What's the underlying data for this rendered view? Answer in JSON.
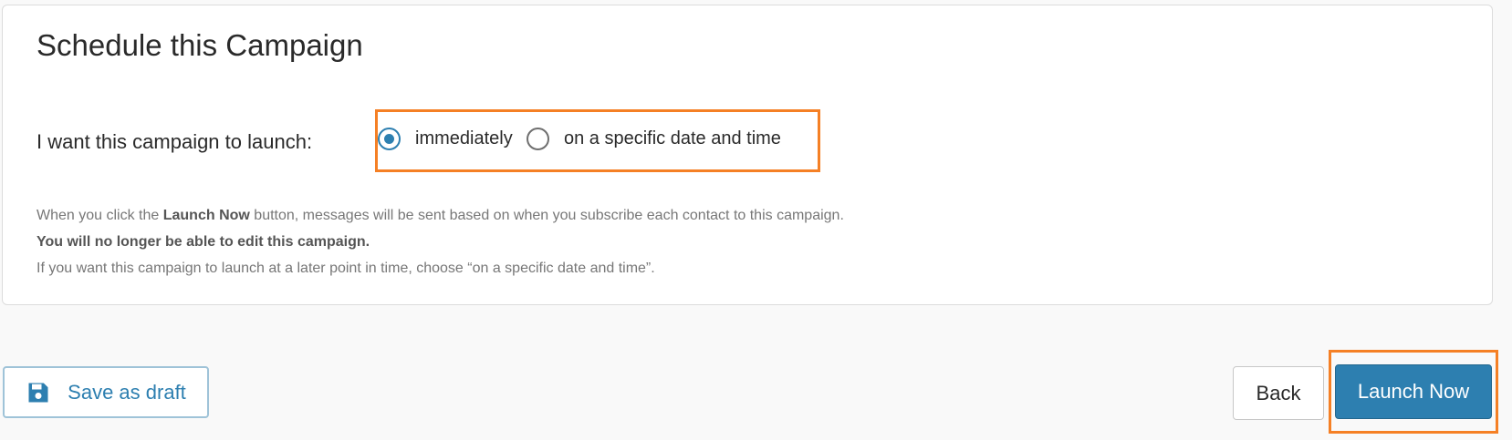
{
  "card": {
    "title": "Schedule this Campaign",
    "launch_label": "I want this campaign to launch:",
    "radio_options": [
      {
        "label": "immediately",
        "selected": true
      },
      {
        "label": "on a specific date and time",
        "selected": false
      }
    ],
    "help": {
      "line1_pre": "When you click the ",
      "line1_bold": "Launch Now",
      "line1_post": " button, messages will be sent based on when you subscribe each contact to this campaign.",
      "line2": "You will no longer be able to edit this campaign.",
      "line3": "If you want this campaign to launch at a later point in time, choose “on a specific date and time”."
    }
  },
  "footer": {
    "save_label": "Save as draft",
    "save_icon": "floppy-disk-icon",
    "back_label": "Back",
    "launch_label": "Launch Now"
  },
  "colors": {
    "accent": "#2d7fb0",
    "highlight": "#f58025"
  }
}
